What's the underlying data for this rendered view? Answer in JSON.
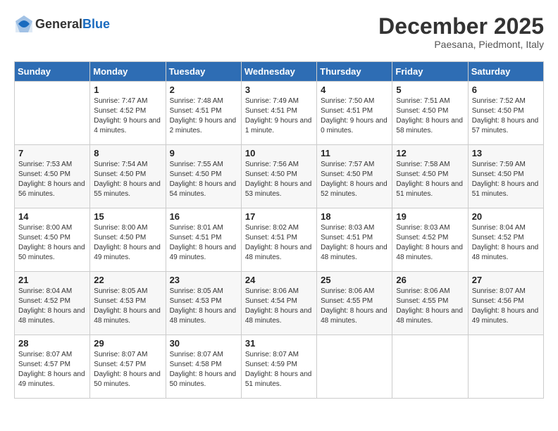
{
  "header": {
    "logo_general": "General",
    "logo_blue": "Blue",
    "month": "December 2025",
    "location": "Paesana, Piedmont, Italy"
  },
  "days_of_week": [
    "Sunday",
    "Monday",
    "Tuesday",
    "Wednesday",
    "Thursday",
    "Friday",
    "Saturday"
  ],
  "weeks": [
    [
      {
        "day": "",
        "sunrise": "",
        "sunset": "",
        "daylight": ""
      },
      {
        "day": "1",
        "sunrise": "Sunrise: 7:47 AM",
        "sunset": "Sunset: 4:52 PM",
        "daylight": "Daylight: 9 hours and 4 minutes."
      },
      {
        "day": "2",
        "sunrise": "Sunrise: 7:48 AM",
        "sunset": "Sunset: 4:51 PM",
        "daylight": "Daylight: 9 hours and 2 minutes."
      },
      {
        "day": "3",
        "sunrise": "Sunrise: 7:49 AM",
        "sunset": "Sunset: 4:51 PM",
        "daylight": "Daylight: 9 hours and 1 minute."
      },
      {
        "day": "4",
        "sunrise": "Sunrise: 7:50 AM",
        "sunset": "Sunset: 4:51 PM",
        "daylight": "Daylight: 9 hours and 0 minutes."
      },
      {
        "day": "5",
        "sunrise": "Sunrise: 7:51 AM",
        "sunset": "Sunset: 4:50 PM",
        "daylight": "Daylight: 8 hours and 58 minutes."
      },
      {
        "day": "6",
        "sunrise": "Sunrise: 7:52 AM",
        "sunset": "Sunset: 4:50 PM",
        "daylight": "Daylight: 8 hours and 57 minutes."
      }
    ],
    [
      {
        "day": "7",
        "sunrise": "Sunrise: 7:53 AM",
        "sunset": "Sunset: 4:50 PM",
        "daylight": "Daylight: 8 hours and 56 minutes."
      },
      {
        "day": "8",
        "sunrise": "Sunrise: 7:54 AM",
        "sunset": "Sunset: 4:50 PM",
        "daylight": "Daylight: 8 hours and 55 minutes."
      },
      {
        "day": "9",
        "sunrise": "Sunrise: 7:55 AM",
        "sunset": "Sunset: 4:50 PM",
        "daylight": "Daylight: 8 hours and 54 minutes."
      },
      {
        "day": "10",
        "sunrise": "Sunrise: 7:56 AM",
        "sunset": "Sunset: 4:50 PM",
        "daylight": "Daylight: 8 hours and 53 minutes."
      },
      {
        "day": "11",
        "sunrise": "Sunrise: 7:57 AM",
        "sunset": "Sunset: 4:50 PM",
        "daylight": "Daylight: 8 hours and 52 minutes."
      },
      {
        "day": "12",
        "sunrise": "Sunrise: 7:58 AM",
        "sunset": "Sunset: 4:50 PM",
        "daylight": "Daylight: 8 hours and 51 minutes."
      },
      {
        "day": "13",
        "sunrise": "Sunrise: 7:59 AM",
        "sunset": "Sunset: 4:50 PM",
        "daylight": "Daylight: 8 hours and 51 minutes."
      }
    ],
    [
      {
        "day": "14",
        "sunrise": "Sunrise: 8:00 AM",
        "sunset": "Sunset: 4:50 PM",
        "daylight": "Daylight: 8 hours and 50 minutes."
      },
      {
        "day": "15",
        "sunrise": "Sunrise: 8:00 AM",
        "sunset": "Sunset: 4:50 PM",
        "daylight": "Daylight: 8 hours and 49 minutes."
      },
      {
        "day": "16",
        "sunrise": "Sunrise: 8:01 AM",
        "sunset": "Sunset: 4:51 PM",
        "daylight": "Daylight: 8 hours and 49 minutes."
      },
      {
        "day": "17",
        "sunrise": "Sunrise: 8:02 AM",
        "sunset": "Sunset: 4:51 PM",
        "daylight": "Daylight: 8 hours and 48 minutes."
      },
      {
        "day": "18",
        "sunrise": "Sunrise: 8:03 AM",
        "sunset": "Sunset: 4:51 PM",
        "daylight": "Daylight: 8 hours and 48 minutes."
      },
      {
        "day": "19",
        "sunrise": "Sunrise: 8:03 AM",
        "sunset": "Sunset: 4:52 PM",
        "daylight": "Daylight: 8 hours and 48 minutes."
      },
      {
        "day": "20",
        "sunrise": "Sunrise: 8:04 AM",
        "sunset": "Sunset: 4:52 PM",
        "daylight": "Daylight: 8 hours and 48 minutes."
      }
    ],
    [
      {
        "day": "21",
        "sunrise": "Sunrise: 8:04 AM",
        "sunset": "Sunset: 4:52 PM",
        "daylight": "Daylight: 8 hours and 48 minutes."
      },
      {
        "day": "22",
        "sunrise": "Sunrise: 8:05 AM",
        "sunset": "Sunset: 4:53 PM",
        "daylight": "Daylight: 8 hours and 48 minutes."
      },
      {
        "day": "23",
        "sunrise": "Sunrise: 8:05 AM",
        "sunset": "Sunset: 4:53 PM",
        "daylight": "Daylight: 8 hours and 48 minutes."
      },
      {
        "day": "24",
        "sunrise": "Sunrise: 8:06 AM",
        "sunset": "Sunset: 4:54 PM",
        "daylight": "Daylight: 8 hours and 48 minutes."
      },
      {
        "day": "25",
        "sunrise": "Sunrise: 8:06 AM",
        "sunset": "Sunset: 4:55 PM",
        "daylight": "Daylight: 8 hours and 48 minutes."
      },
      {
        "day": "26",
        "sunrise": "Sunrise: 8:06 AM",
        "sunset": "Sunset: 4:55 PM",
        "daylight": "Daylight: 8 hours and 48 minutes."
      },
      {
        "day": "27",
        "sunrise": "Sunrise: 8:07 AM",
        "sunset": "Sunset: 4:56 PM",
        "daylight": "Daylight: 8 hours and 49 minutes."
      }
    ],
    [
      {
        "day": "28",
        "sunrise": "Sunrise: 8:07 AM",
        "sunset": "Sunset: 4:57 PM",
        "daylight": "Daylight: 8 hours and 49 minutes."
      },
      {
        "day": "29",
        "sunrise": "Sunrise: 8:07 AM",
        "sunset": "Sunset: 4:57 PM",
        "daylight": "Daylight: 8 hours and 50 minutes."
      },
      {
        "day": "30",
        "sunrise": "Sunrise: 8:07 AM",
        "sunset": "Sunset: 4:58 PM",
        "daylight": "Daylight: 8 hours and 50 minutes."
      },
      {
        "day": "31",
        "sunrise": "Sunrise: 8:07 AM",
        "sunset": "Sunset: 4:59 PM",
        "daylight": "Daylight: 8 hours and 51 minutes."
      },
      {
        "day": "",
        "sunrise": "",
        "sunset": "",
        "daylight": ""
      },
      {
        "day": "",
        "sunrise": "",
        "sunset": "",
        "daylight": ""
      },
      {
        "day": "",
        "sunrise": "",
        "sunset": "",
        "daylight": ""
      }
    ]
  ]
}
